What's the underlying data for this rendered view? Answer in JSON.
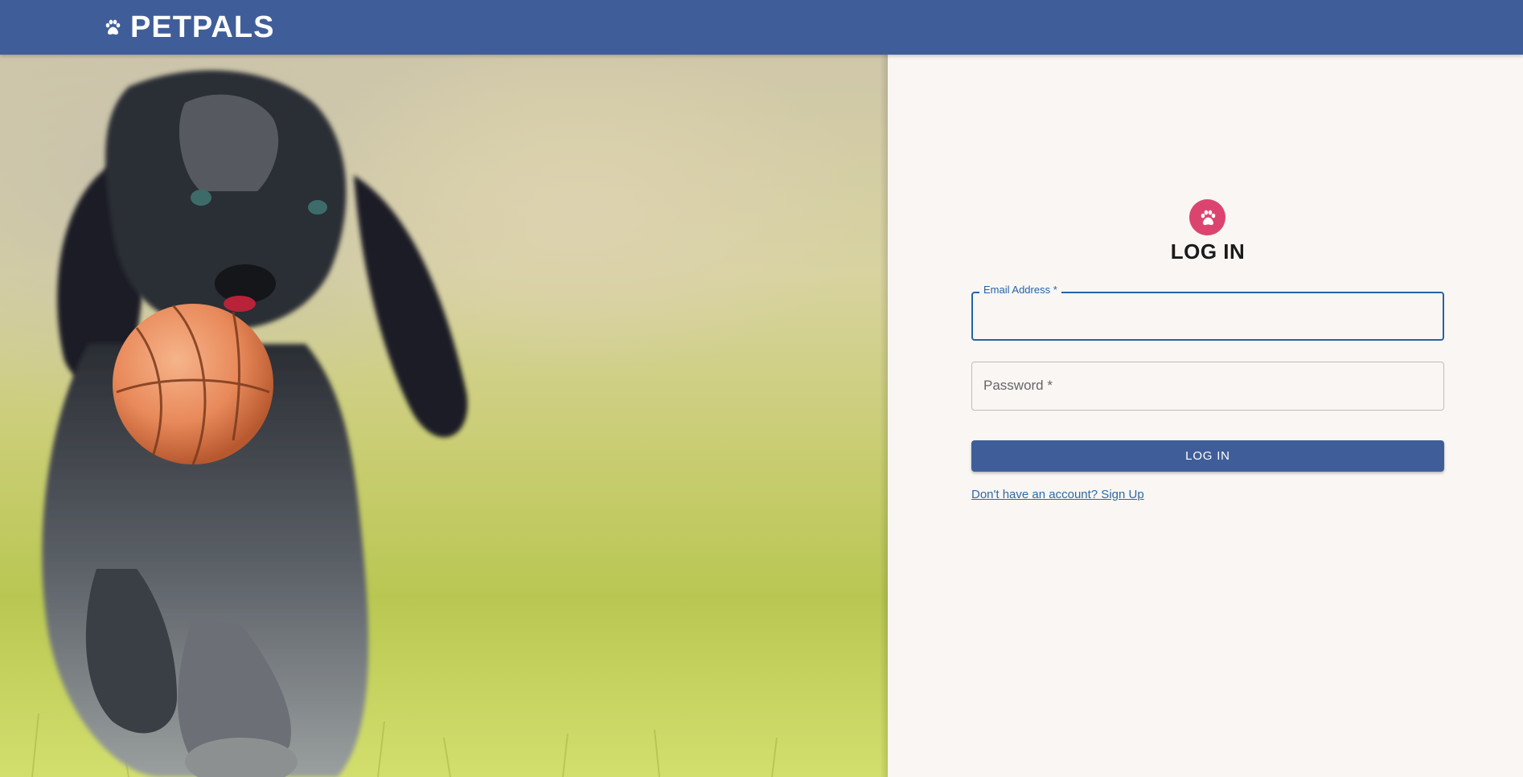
{
  "appbar": {
    "brand": "PETPALS",
    "brand_icon": "paw-icon",
    "color": "#3f5e99"
  },
  "hero": {
    "image": "puppy-with-ball-photo"
  },
  "login": {
    "avatar_icon": "paw-icon",
    "avatar_color": "#dc4470",
    "title": "LOG IN",
    "email_label": "Email Address *",
    "email_value": "",
    "password_label": "Password *",
    "password_value": "",
    "submit_label": "LOG IN",
    "signup_link": "Don't have an account? Sign Up"
  }
}
